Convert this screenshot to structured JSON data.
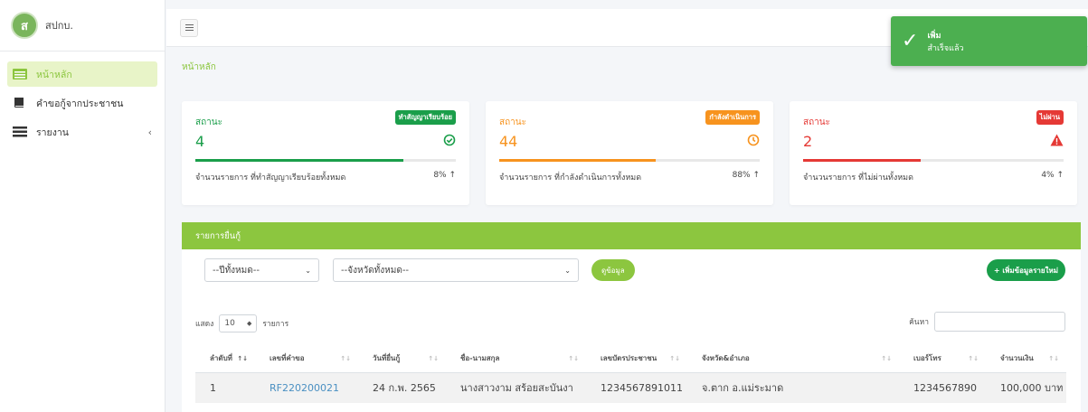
{
  "brand": {
    "name": "สปกบ."
  },
  "sidebar": {
    "items": [
      {
        "label": "หน้าหลัก",
        "icon": "table-icon"
      },
      {
        "label": "คำขอกู้จากประชาชน",
        "icon": "book-icon"
      },
      {
        "label": "รายงาน",
        "icon": "list-icon"
      }
    ]
  },
  "breadcrumb": "หน้าหลัก",
  "toast": {
    "title": "เพิ่ม",
    "message": "สำเร็จแล้ว"
  },
  "cards": [
    {
      "label": "สถานะ",
      "badge": "ทำสัญญาเรียบร้อย",
      "value": "4",
      "desc": "จำนวนรายการ ที่ทำสัญญาเรียบร้อยทั้งหมด",
      "pct": "8% ↑",
      "color": "#1a9e4a",
      "progress": 0.8
    },
    {
      "label": "สถานะ",
      "badge": "กำลังดำเนินการ",
      "value": "44",
      "desc": "จำนวนรายการ ที่กำลังดำเนินการทั้งหมด",
      "pct": "88% ↑",
      "color": "#f7931e",
      "progress": 0.6
    },
    {
      "label": "สถานะ",
      "badge": "ไม่ผ่าน",
      "value": "2",
      "desc": "จำนวนรายการ ที่ไม่ผ่านทั้งหมด",
      "pct": "4% ↑",
      "color": "#e53935",
      "progress": 0.45
    }
  ],
  "panel": {
    "title": "รายการยื่นกู้",
    "year_select": "--ปีทั้งหมด--",
    "province_select": "--จังหวัดทั้งหมด--",
    "view_btn": "ดูข้อมูล",
    "add_btn": "+ เพิ่มข้อมูลรายใหม่",
    "show_label": "แสดง",
    "page_len": "10",
    "entries_label": "รายการ",
    "search_label": "ค้นหา"
  },
  "table": {
    "headers": [
      "ลำดับที่",
      "เลขที่คำขอ",
      "วันที่ยื่นกู้",
      "ชื่อ-นามสกุล",
      "เลขบัตรประชาชน",
      "จังหวัด&อำเภอ",
      "เบอร์โทร",
      "จำนวนเงิน"
    ],
    "rows": [
      [
        "1",
        "RF220200021",
        "24 ก.พ. 2565",
        "นางสาวงาม สร้อยสะบันงา",
        "1234567891011",
        "จ.ตาก อ.แม่ระมาด",
        "1234567890",
        "100,000 บาท"
      ]
    ]
  }
}
